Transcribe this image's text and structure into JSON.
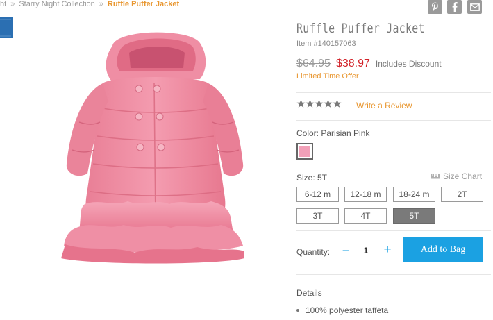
{
  "breadcrumb": {
    "items": [
      "ht",
      "Starry Night Collection",
      "Ruffle Puffer Jacket"
    ],
    "separator": "»"
  },
  "share": {
    "icons": [
      "pinterest-icon",
      "facebook-icon",
      "email-icon"
    ]
  },
  "product": {
    "title": "Ruffle Puffer Jacket",
    "item_number": "Item #140157063",
    "image_icon": "pink-puffer-jacket-image"
  },
  "price": {
    "original": "$64.95",
    "sale": "$38.97",
    "note": "Includes Discount",
    "offer": "Limited Time Offer"
  },
  "rating": {
    "stars_filled": 5,
    "stars_total": 5,
    "review_link": "Write a Review"
  },
  "color": {
    "label": "Color: Parisian Pink",
    "swatch_hex": "#f2a0b8"
  },
  "size": {
    "label": "Size: 5T",
    "chart_link": "Size Chart",
    "options": [
      "6-12 m",
      "12-18 m",
      "18-24 m",
      "2T",
      "3T",
      "4T",
      "5T"
    ],
    "selected": "5T"
  },
  "quantity": {
    "label": "Quantity:",
    "minus": "−",
    "value": "1",
    "plus": "+"
  },
  "cart": {
    "add_label": "Add to Bag"
  },
  "details": {
    "title": "Details",
    "items": [
      "100% polyester taffeta"
    ]
  },
  "colors": {
    "accent_orange": "#e8962f",
    "sale_red": "#d2232a",
    "button_blue": "#1ba1e2",
    "selected_gray": "#7a7a7a"
  }
}
